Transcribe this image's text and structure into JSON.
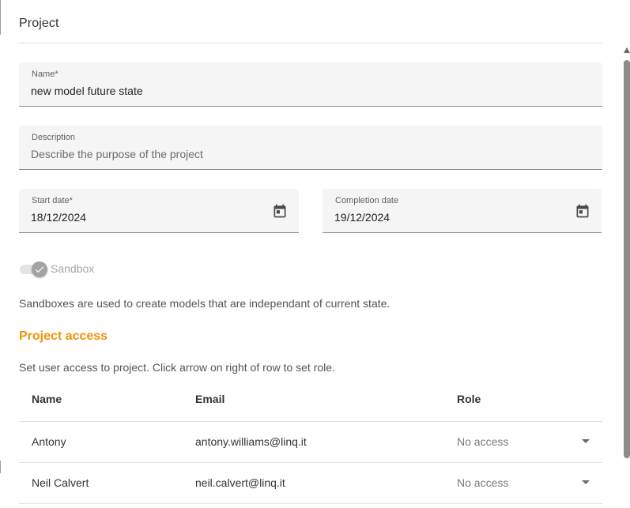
{
  "section": {
    "title": "Project"
  },
  "name_field": {
    "label": "Name*",
    "value": "new model future state"
  },
  "description_field": {
    "label": "Description",
    "placeholder": "Describe the purpose of the project"
  },
  "start_date_field": {
    "label": "Start date*",
    "value": "18/12/2024",
    "icon": "calendar-icon"
  },
  "completion_date_field": {
    "label": "Completion date",
    "value": "19/12/2024",
    "icon": "calendar-icon"
  },
  "sandbox": {
    "label": "Sandbox",
    "checked": true,
    "disabled": true,
    "helper": "Sandboxes are used to create models that are independant of current state."
  },
  "project_access": {
    "title": "Project access",
    "helper": "Set user access to project. Click arrow on right of row to set role.",
    "columns": [
      "Name",
      "Email",
      "Role"
    ],
    "rows": [
      {
        "name": "Antony",
        "email": "antony.williams@linq.it",
        "role": "No access"
      },
      {
        "name": "Neil Calvert",
        "email": "neil.calvert@linq.it",
        "role": "No access"
      }
    ]
  },
  "colors": {
    "accent": "#f0930a",
    "field_background": "#f5f5f5",
    "divider": "#e0e0e0",
    "scrollbar": "#8c8c8c"
  }
}
